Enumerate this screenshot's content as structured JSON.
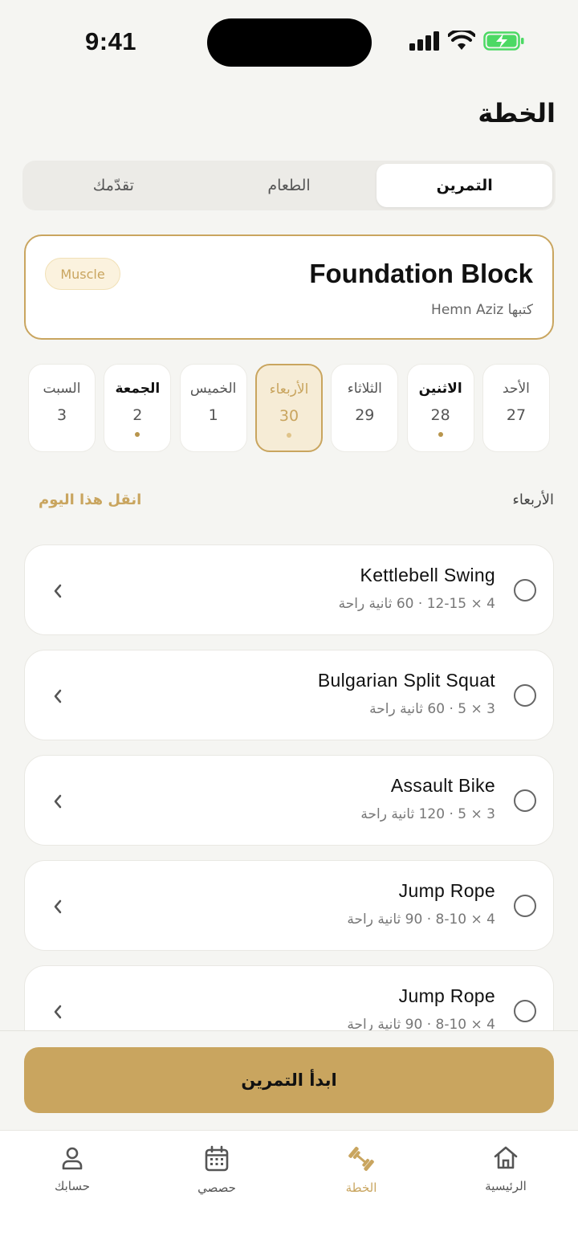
{
  "status": {
    "time": "9:41"
  },
  "header": {
    "title": "الخطة"
  },
  "segments": [
    {
      "label": "التمرين",
      "active": true
    },
    {
      "label": "الطعام",
      "active": false
    },
    {
      "label": "تقدّمك",
      "active": false
    }
  ],
  "plan": {
    "name": "Foundation Block",
    "author": "كتبها Hemn Aziz",
    "tag": "Muscle"
  },
  "days": [
    {
      "name": "الأحد",
      "num": "27",
      "dot": false,
      "bold": false,
      "selected": false
    },
    {
      "name": "الاثنين",
      "num": "28",
      "dot": true,
      "bold": true,
      "selected": false
    },
    {
      "name": "الثلاثاء",
      "num": "29",
      "dot": false,
      "bold": false,
      "selected": false
    },
    {
      "name": "الأربعاء",
      "num": "30",
      "dot": true,
      "bold": false,
      "selected": true
    },
    {
      "name": "الخميس",
      "num": "1",
      "dot": false,
      "bold": false,
      "selected": false
    },
    {
      "name": "الجمعة",
      "num": "2",
      "dot": true,
      "bold": true,
      "selected": false
    },
    {
      "name": "السبت",
      "num": "3",
      "dot": false,
      "bold": false,
      "selected": false
    }
  ],
  "section": {
    "day_label": "الأربعاء",
    "move_label": "انقل هذا اليوم"
  },
  "exercises": [
    {
      "name": "Kettlebell Swing",
      "detail": "4 × 12-15 · 60 ثانية راحة"
    },
    {
      "name": "Bulgarian Split Squat",
      "detail": "3 × 5 · 60 ثانية راحة"
    },
    {
      "name": "Assault Bike",
      "detail": "3 × 5 · 120 ثانية راحة"
    },
    {
      "name": "Jump Rope",
      "detail": "4 × 8-10 · 90 ثانية راحة"
    },
    {
      "name": "Jump Rope",
      "detail": "4 × 8-10 · 90 ثانية راحة"
    }
  ],
  "cta": {
    "label": "ابدأ التمرين"
  },
  "tabbar": {
    "home": "الرئيسية",
    "plan": "الخطة",
    "sessions": "حصصي",
    "account": "حسابك"
  },
  "colors": {
    "accent": "#c9a55f",
    "background": "#f5f5f2"
  }
}
